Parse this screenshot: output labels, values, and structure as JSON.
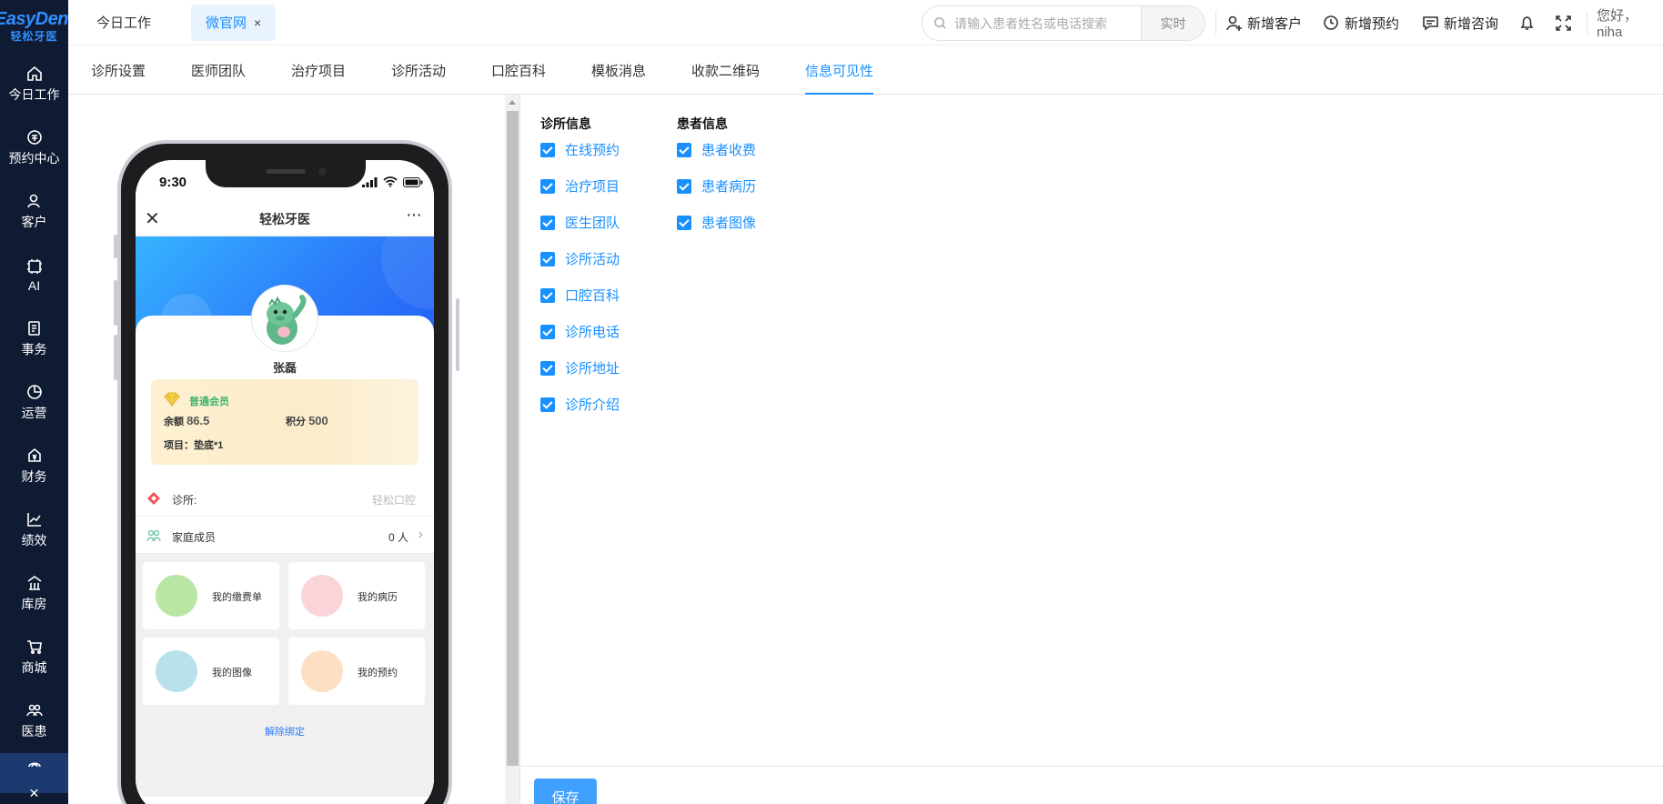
{
  "logo": {
    "en": "EasyDent",
    "cn": "轻松牙医"
  },
  "sidebar": {
    "items": [
      {
        "label": "今日工作",
        "icon": "home-icon"
      },
      {
        "label": "预约中心",
        "icon": "appointment-icon"
      },
      {
        "label": "客户",
        "icon": "user-icon"
      },
      {
        "label": "AI",
        "icon": "ai-chip-icon"
      },
      {
        "label": "事务",
        "icon": "task-icon"
      },
      {
        "label": "运营",
        "icon": "pie-chart-icon"
      },
      {
        "label": "财务",
        "icon": "finance-icon"
      },
      {
        "label": "绩效",
        "icon": "line-chart-icon"
      },
      {
        "label": "库房",
        "icon": "warehouse-icon"
      },
      {
        "label": "商城",
        "icon": "cart-icon"
      },
      {
        "label": "医患",
        "icon": "doctor-patient-icon"
      }
    ]
  },
  "topbar": {
    "tabs": [
      {
        "label": "今日工作"
      },
      {
        "label": "微官网",
        "close": "×"
      }
    ],
    "search": {
      "placeholder": "请输入患者姓名或电话搜索",
      "mode": "实时"
    },
    "actions": {
      "new_customer": "新增客户",
      "new_appointment": "新增预约",
      "new_consult": "新增咨询"
    },
    "greeting": "您好，niha"
  },
  "subtabs": [
    "诊所设置",
    "医师团队",
    "治疗项目",
    "诊所活动",
    "口腔百科",
    "模板消息",
    "收款二维码",
    "信息可见性"
  ],
  "phone": {
    "time": "9:30",
    "title": "轻松牙医",
    "close": "✕",
    "more": "···",
    "user_name": "张磊",
    "member_level": "普通会员",
    "balance_label": "余额",
    "balance": "86.5",
    "points_label": "积分",
    "points": "500",
    "project": "项目：垫底*1",
    "clinic_label": "诊所:",
    "clinic_value": "轻松口腔",
    "family_label": "家庭成员",
    "family_value": "0 人",
    "tiles": [
      "我的缴费单",
      "我的病历",
      "我的图像",
      "我的预约"
    ],
    "unbind": "解除绑定"
  },
  "settings": {
    "clinic_title": "诊所信息",
    "clinic_items": [
      "在线预约",
      "治疗项目",
      "医生团队",
      "诊所活动",
      "口腔百科",
      "诊所电话",
      "诊所地址",
      "诊所介绍"
    ],
    "patient_title": "患者信息",
    "patient_items": [
      "患者收费",
      "患者病历",
      "患者图像"
    ],
    "save": "保存"
  },
  "colors": {
    "sidebar_bg": "#0f1b33",
    "accent": "#1890ff",
    "hero_blue": "#2c7bfa"
  }
}
